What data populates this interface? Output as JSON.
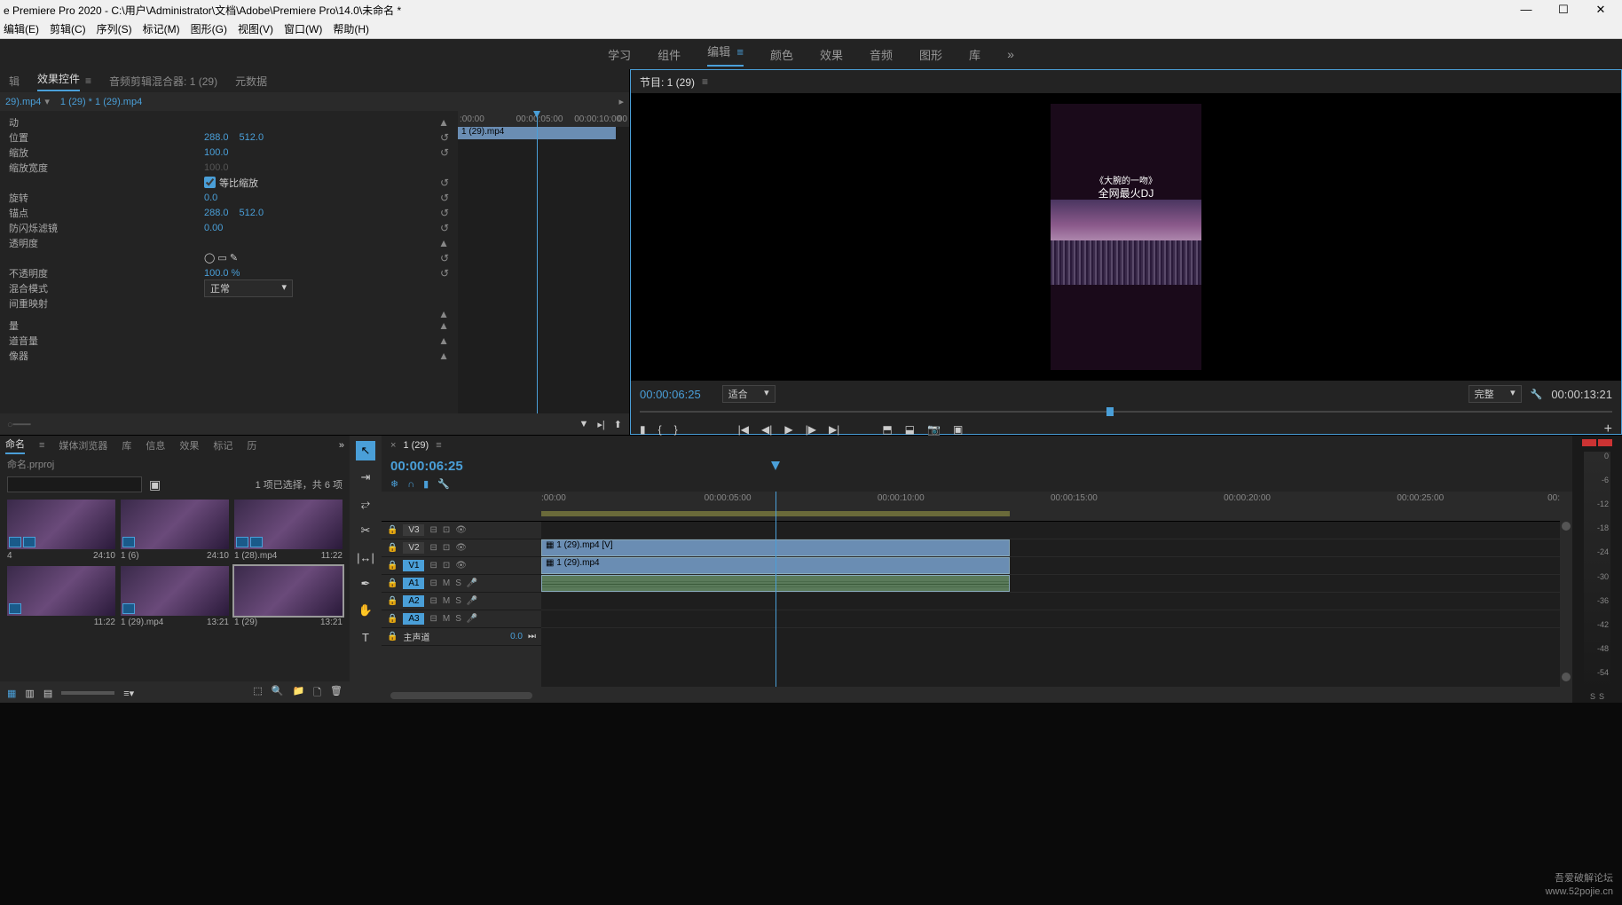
{
  "window": {
    "title": "e Premiere Pro 2020 - C:\\用户\\Administrator\\文档\\Adobe\\Premiere Pro\\14.0\\未命名 *"
  },
  "menubar": [
    "编辑(E)",
    "剪辑(C)",
    "序列(S)",
    "标记(M)",
    "图形(G)",
    "视图(V)",
    "窗口(W)",
    "帮助(H)"
  ],
  "workspaces": {
    "items": [
      "学习",
      "组件",
      "编辑",
      "颜色",
      "效果",
      "音频",
      "图形",
      "库"
    ],
    "active_index": 2
  },
  "source_panel": {
    "tabs": [
      "辑",
      "效果控件",
      "音频剪辑混合器: 1 (29)",
      "元数据"
    ],
    "active_index": 1,
    "clip_label": "29).mp4",
    "sequence_label": "1 (29) * 1 (29).mp4",
    "timeline_marks": [
      ":00:00",
      "00:00:05:00",
      "00:00:10:00",
      "00"
    ],
    "clip_bar_label": "1 (29).mp4",
    "playhead_pct": 46
  },
  "effect_controls": {
    "rows": [
      {
        "label": "动",
        "reset": "▲"
      },
      {
        "label": "位置",
        "val1": "288.0",
        "val2": "512.0",
        "reset": "↺"
      },
      {
        "label": "缩放",
        "val1": "100.0",
        "reset": "↺"
      },
      {
        "label": "缩放宽度",
        "val_dim": "100.0"
      },
      {
        "label": "",
        "checkbox": true,
        "cb_label": "等比缩放",
        "reset": "↺"
      },
      {
        "label": "旋转",
        "val1": "0.0",
        "reset": "↺"
      },
      {
        "label": "锚点",
        "val1": "288.0",
        "val2": "512.0",
        "reset": "↺"
      },
      {
        "label": "防闪烁滤镜",
        "val1": "0.00",
        "reset": "↺"
      },
      {
        "label": "透明度",
        "reset": "▲"
      },
      {
        "label": "",
        "shapes": true,
        "reset": "↺"
      },
      {
        "label": "不透明度",
        "val1": "100.0 %",
        "reset": "↺"
      },
      {
        "label": "混合模式",
        "dropdown": "正常"
      },
      {
        "label": "间重映射"
      },
      {
        "label": ""
      },
      {
        "label": "量",
        "reset": "▲"
      },
      {
        "label": "道音量",
        "reset": "▲"
      },
      {
        "label": "像器",
        "reset": "▲"
      }
    ]
  },
  "program": {
    "title": "节目: 1 (29)",
    "overlay_title": "《大腕的一吻》",
    "overlay_sub": "全网最火DJ",
    "time": "00:00:06:25",
    "zoom": "适合",
    "quality": "完整",
    "duration": "00:00:13:21",
    "scrub_pct": 48
  },
  "project": {
    "tabs": [
      "命名",
      "媒体浏览器",
      "库",
      "信息",
      "效果",
      "标记",
      "历"
    ],
    "active_index": 0,
    "path": "命名.prproj",
    "search_placeholder": "",
    "status": "1 项已选择，共 6 项",
    "items": [
      {
        "name": "4",
        "dur": "24:10",
        "badges": 2
      },
      {
        "name": "1 (6)",
        "dur": "24:10",
        "badges": 1
      },
      {
        "name": "1 (28).mp4",
        "dur": "11:22",
        "badges": 2
      },
      {
        "name": "",
        "dur": "11:22",
        "badges": 1
      },
      {
        "name": "1 (29).mp4",
        "dur": "13:21",
        "badges": 1
      },
      {
        "name": "1 (29)",
        "dur": "13:21",
        "badges": 0,
        "selected": true
      }
    ]
  },
  "timeline": {
    "sequence": "1 (29)",
    "time": "00:00:06:25",
    "ruler_marks": [
      ":00:00",
      "00:00:05:00",
      "00:00:10:00",
      "00:00:15:00",
      "00:00:20:00",
      "00:00:25:00",
      "00:"
    ],
    "workarea_pct": 46,
    "playhead_pct": 23,
    "tracks": [
      {
        "id": "V3",
        "type": "v"
      },
      {
        "id": "V2",
        "type": "v",
        "clip": {
          "label": "1 (29).mp4 [V]",
          "start_pct": 0,
          "width_pct": 46
        }
      },
      {
        "id": "V1",
        "type": "v",
        "targeted": true,
        "clip": {
          "label": "1 (29).mp4",
          "start_pct": 0,
          "width_pct": 46
        }
      },
      {
        "id": "A1",
        "type": "a",
        "targeted": true,
        "clip": {
          "label": "",
          "start_pct": 0,
          "width_pct": 46,
          "audio": true
        }
      },
      {
        "id": "A2",
        "type": "a",
        "targeted": true
      },
      {
        "id": "A3",
        "type": "a",
        "targeted": true
      }
    ],
    "master": {
      "label": "主声道",
      "val": "0.0"
    }
  },
  "meters": {
    "ticks": [
      "0",
      "-6",
      "-12",
      "-18",
      "-24",
      "-30",
      "-36",
      "-42",
      "-48",
      "-54"
    ],
    "footer": [
      "S",
      "S"
    ]
  },
  "watermark": {
    "line1": "吾爱破解论坛",
    "line2": "www.52pojie.cn"
  }
}
